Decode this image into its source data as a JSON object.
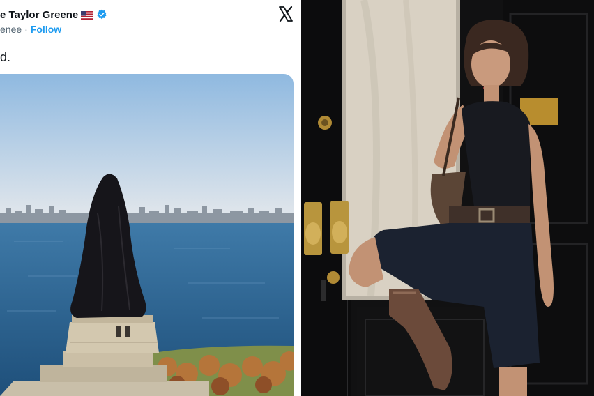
{
  "tweet": {
    "author_name": "e Taylor Greene",
    "handle": "enee",
    "separator": "·",
    "follow_label": "Follow",
    "text": "d.",
    "icons": {
      "flag": "us-flag-icon",
      "verified": "verified-badge-icon",
      "platform": "x-logo-icon"
    },
    "colors": {
      "follow": "#1d9bf0",
      "verified": "#1d9bf0",
      "name": "#0f1419",
      "handle": "#536471"
    }
  },
  "images": {
    "tweet_photo": "statue-draped-in-black-cloth-over-harbor",
    "right_photo": "woman-posing-at-black-door"
  }
}
